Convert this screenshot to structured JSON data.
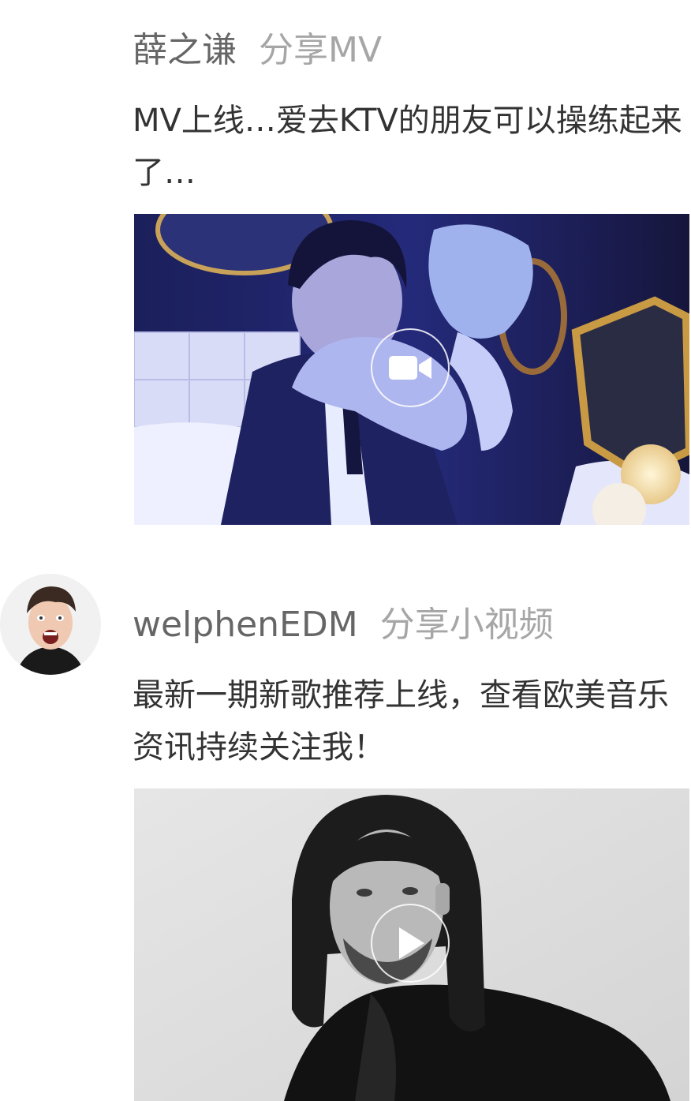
{
  "feed": {
    "posts": [
      {
        "author": "薛之谦",
        "share_type": "分享MV",
        "text": "MV上线…爱去KTV的朋友可以操练起来了…",
        "media_icon": "video-camera-icon"
      },
      {
        "author": "welphenEDM",
        "share_type": "分享小视频",
        "text": "最新一期新歌推荐上线，查看欧美音乐资讯持续关注我！",
        "media_icon": "play-icon"
      }
    ]
  },
  "colors": {
    "author": "#666666",
    "share_type": "#a6a6a6",
    "text": "#333333",
    "background": "#ffffff"
  }
}
